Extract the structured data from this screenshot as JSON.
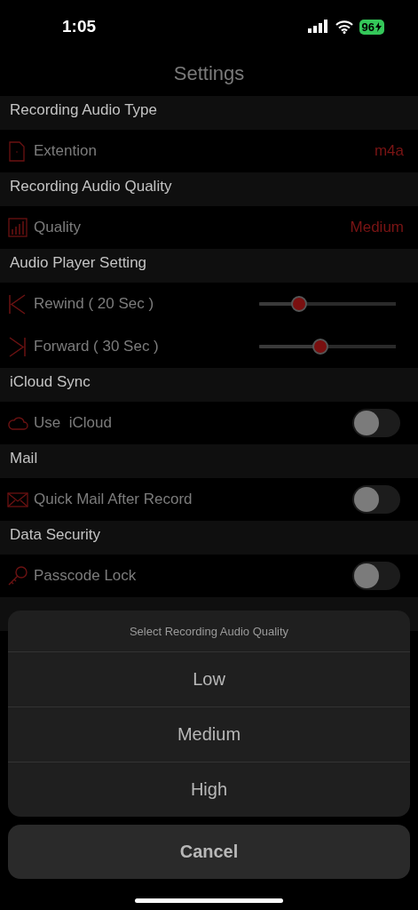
{
  "status_bar": {
    "time": "1:05",
    "battery": "96"
  },
  "title": "Settings",
  "sections": [
    {
      "header": "Recording Audio Type",
      "rows": [
        {
          "kind": "value",
          "label": "Extention",
          "value": "m4a"
        }
      ]
    },
    {
      "header": "Recording Audio Quality",
      "rows": [
        {
          "kind": "value",
          "label": "Quality",
          "value": "Medium"
        }
      ]
    },
    {
      "header": "Audio Player Setting",
      "rows": [
        {
          "kind": "slider",
          "label": "Rewind ( 20 Sec )",
          "level": 0.29
        },
        {
          "kind": "slider",
          "label": "Forward ( 30 Sec )",
          "level": 0.45
        }
      ]
    },
    {
      "header": "iCloud Sync",
      "rows": [
        {
          "kind": "toggle",
          "label": "Use  iCloud",
          "on": false
        }
      ]
    },
    {
      "header": "Mail",
      "rows": [
        {
          "kind": "toggle",
          "label": "Quick Mail After Record",
          "on": false
        }
      ]
    },
    {
      "header": "Data Security",
      "rows": [
        {
          "kind": "toggle",
          "label": "Passcode Lock",
          "on": false
        }
      ]
    }
  ],
  "action_sheet": {
    "title": "Select Recording Audio Quality",
    "options": [
      "Low",
      "Medium",
      "High"
    ],
    "cancel": "Cancel"
  }
}
